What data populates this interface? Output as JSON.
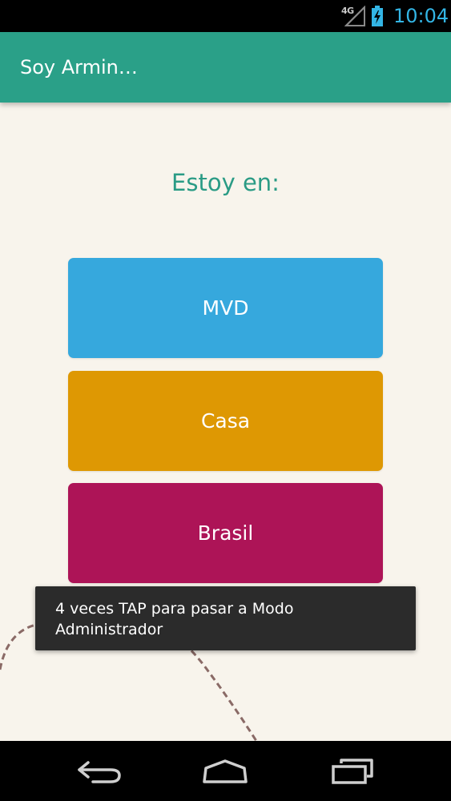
{
  "status_bar": {
    "network": "4G",
    "time": "10:04",
    "signal_icon": "signal-icon",
    "battery_icon": "battery-charging-icon"
  },
  "app_bar": {
    "title": "Soy Armin…"
  },
  "main": {
    "heading": "Estoy en:",
    "buttons": [
      {
        "label": "MVD",
        "color": "#36a8dd"
      },
      {
        "label": "Casa",
        "color": "#de9803"
      },
      {
        "label": "Brasil",
        "color": "#ad1457"
      }
    ]
  },
  "toast": {
    "message": "4 veces TAP para pasar a Modo Administrador"
  },
  "nav_bar": {
    "back_icon": "back-icon",
    "home_icon": "home-icon",
    "recents_icon": "recents-icon"
  },
  "colors": {
    "accent": "#2aa088",
    "heading": "#2a9b85",
    "background": "#f8f4ec",
    "status_time": "#33b5e5"
  }
}
